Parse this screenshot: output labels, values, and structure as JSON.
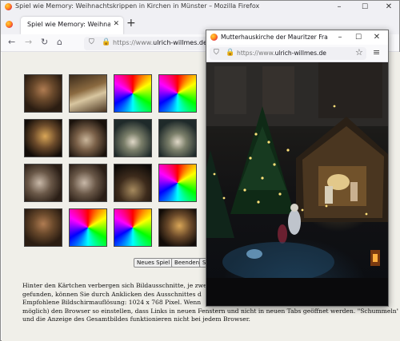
{
  "main_window": {
    "title": "Spiel wie Memory: Weihnachtskrippen in Kirchen in Münster – Mozilla Firefox",
    "controls": {
      "minimize": "–",
      "maximize": "☐",
      "close": "✕"
    },
    "tab": {
      "label": "Spiel wie Memory: Weihnachtskripp",
      "close": "✕"
    },
    "new_tab": "+",
    "url": {
      "domain": "https://www.",
      "host": "ulrich-willmes.de"
    }
  },
  "page": {
    "grid": [
      [
        "photo-a",
        "photo-b",
        "rainbow",
        "rainbow"
      ],
      [
        "photo-e",
        "photo-c",
        "photo-d",
        "photo-d"
      ],
      [
        "photo-f",
        "photo-f",
        "photo-g",
        "rainbow"
      ],
      [
        "photo-a",
        "rainbow",
        "rainbow",
        "photo-e"
      ]
    ],
    "buttons": {
      "new_game": "Neues Spiel",
      "end": "Beenden",
      "partial": "Sc"
    },
    "description": [
      "Hinter den Kärtchen verbergen sich Bildausschnitte, je zwei sin",
      "gefunden, können Sie durch Anklicken des Ausschnittes d",
      "Empfohlene Bildschirmauflösung: 1024 x 768 Pixel. Wenn",
      "möglich) den Browser so einstellen, dass Links in neuen Fenstern und nicht in neuen Tabs geöffnet werden. \"Schummeln\"",
      "und die Anzeige des Gesamtbildes funktionieren nicht bei jedem Browser."
    ]
  },
  "popup": {
    "title": "Mutterhauskirche der Mauritzer Franziskan...",
    "controls": {
      "minimize": "–",
      "maximize": "☐",
      "close": "✕"
    },
    "url": {
      "domain": "https://www.",
      "host": "ulrich-willmes.de"
    }
  }
}
